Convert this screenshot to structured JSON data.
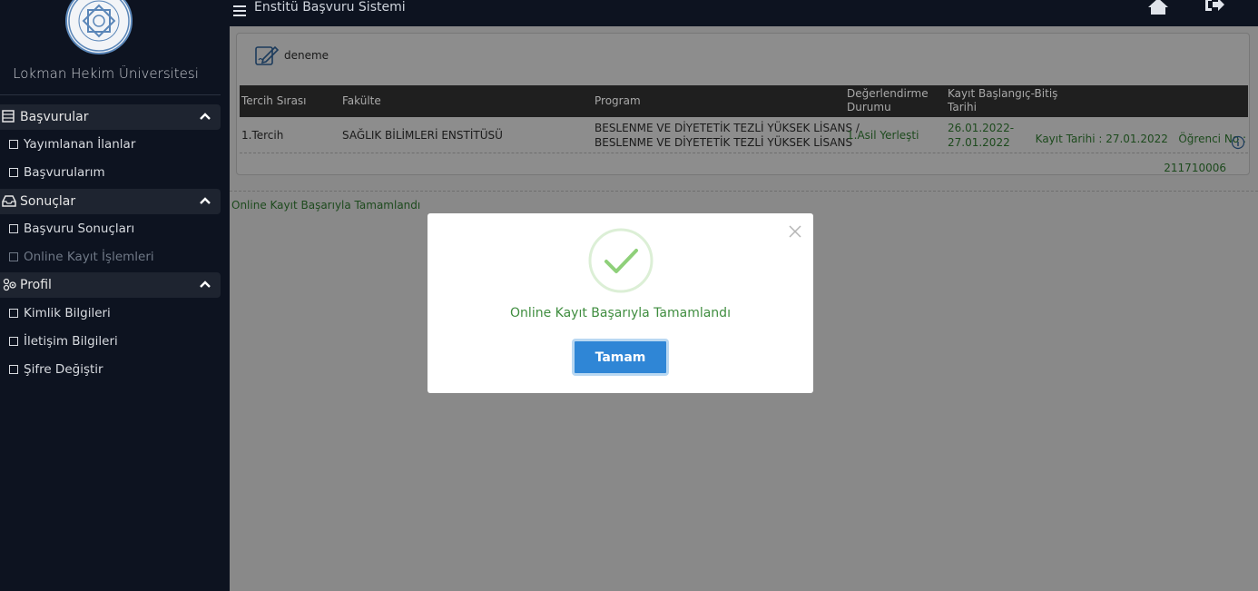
{
  "sidebar": {
    "university_name": "Lokman Hekim Üniversitesi",
    "logo_text": "LOKMAN HEKİM ÜNİVERSİTESİ",
    "sections": [
      {
        "title": "Başvurular",
        "icon": "building-icon",
        "items": [
          {
            "label": "Yayımlanan İlanlar"
          },
          {
            "label": "Başvurularım"
          }
        ]
      },
      {
        "title": "Sonuçlar",
        "icon": "inbox-icon",
        "items": [
          {
            "label": "Başvuru Sonuçları"
          },
          {
            "label": "Online Kayıt İşlemleri"
          }
        ]
      },
      {
        "title": "Profil",
        "icon": "users-cog-icon",
        "items": [
          {
            "label": "Kimlik Bilgileri"
          },
          {
            "label": "İletişim Bilgileri"
          },
          {
            "label": "Şifre Değiştir"
          }
        ]
      }
    ]
  },
  "topbar": {
    "title": "Enstitü Başvuru Sistemi"
  },
  "panel": {
    "title": "deneme",
    "columns": [
      "Tercih Sırası",
      "Fakülte",
      "Program",
      "Değerlendirme Durumu",
      "Kayıt Başlangıç-Bitiş Tarihi",
      ""
    ],
    "column_lines": {
      "evaluation": [
        "Değerlendirme",
        "Durumu"
      ],
      "dates": [
        "Kayıt Başlangıç-Bitiş",
        "Tarihi"
      ]
    },
    "row": {
      "order": "1.Tercih",
      "faculty": "SAĞLIK BİLİMLERİ ENSTİTÜSÜ",
      "program_line1": "BESLENME VE DİYETETİK TEZLİ YÜKSEK LİSANS /",
      "program_line2": "BESLENME VE DİYETETİK TEZLİ YÜKSEK LİSANS",
      "status": "1.Asil Yerleşti",
      "date_line1": "26.01.2022-",
      "date_line2": "27.01.2022",
      "reg_info_line1": "Kayıt Tarihi : 27.01.2022   Öğrenci No :",
      "reg_info_line2": "211710006"
    }
  },
  "status_text": "Online Kayıt Başarıyla Tamamlandı",
  "modal": {
    "message": "Online Kayıt Başarıyla Tamamlandı",
    "ok_label": "Tamam"
  },
  "colors": {
    "sidebar_bg": "#0d1320",
    "overlay_bg": "#898989",
    "accent": "#2f86d6",
    "success": "#3f8d3f"
  }
}
